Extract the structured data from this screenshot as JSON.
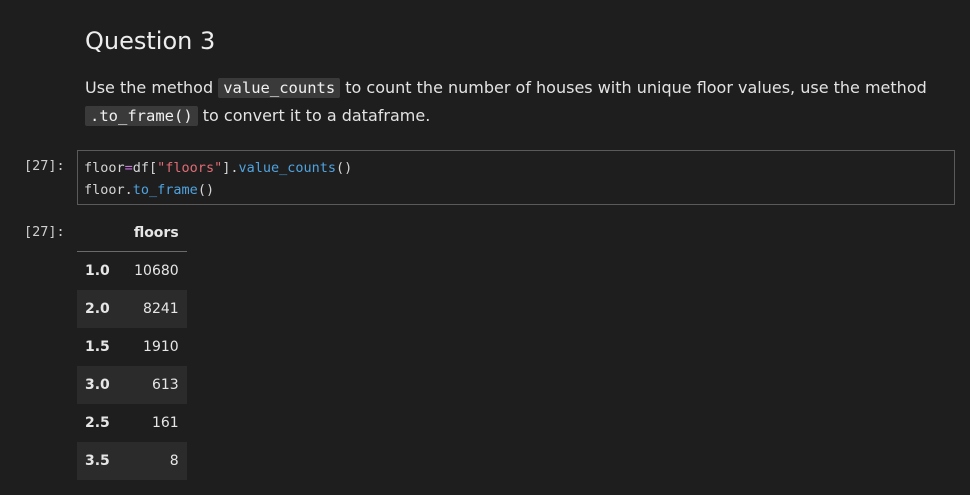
{
  "markdown": {
    "title": "Question 3",
    "para_1": "Use the method ",
    "code_1": "value_counts",
    "para_2": " to count the number of houses with unique floor values, use the method",
    "code_2": ".to_frame()",
    "para_3": " to convert it to a dataframe."
  },
  "input_cell": {
    "prompt": "[27]:",
    "line1": {
      "a": "floor",
      "op": "=",
      "b": "df[",
      "str": "\"floors\"",
      "c": "].",
      "fn": "value_counts",
      "d": "()"
    },
    "line2": {
      "a": "floor.",
      "fn": "to_frame",
      "d": "()"
    }
  },
  "output_cell": {
    "prompt": "[27]:",
    "column_header": "floors",
    "rows": [
      {
        "index": "1.0",
        "value": "10680"
      },
      {
        "index": "2.0",
        "value": "8241"
      },
      {
        "index": "1.5",
        "value": "1910"
      },
      {
        "index": "3.0",
        "value": "613"
      },
      {
        "index": "2.5",
        "value": "161"
      },
      {
        "index": "3.5",
        "value": "8"
      }
    ]
  }
}
